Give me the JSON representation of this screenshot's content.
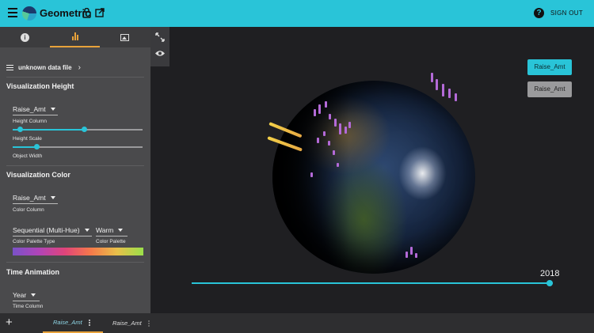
{
  "header": {
    "app_title": "Geometric",
    "sign_out_label": "SIGN OUT",
    "help_glyph": "?",
    "icons": [
      "menu-icon",
      "geometric-logo",
      "lock-icon",
      "open-external-icon",
      "help-icon"
    ]
  },
  "sidebar": {
    "tabs": [
      {
        "icon": "info-icon",
        "glyph": "i",
        "active": false
      },
      {
        "icon": "bar-chart-icon",
        "active": true
      },
      {
        "icon": "image-icon",
        "active": false
      }
    ],
    "data_file_label": "unknown data file",
    "chevron_glyph": "›",
    "height_section": {
      "title": "Visualization Height",
      "height_column_value": "Raise_Amt",
      "height_column_label": "Height Column",
      "height_scale_label": "Height Scale",
      "height_scale_value": 0.55,
      "object_width_label": "Object Width",
      "object_width_value": 0.18
    },
    "color_section": {
      "title": "Visualization Color",
      "color_column_value": "Raise_Amt",
      "color_column_label": "Color Column",
      "palette_type_value": "Sequential (Multi-Hue)",
      "palette_type_label": "Color Palette Type",
      "palette_value": "Warm",
      "palette_label": "Color Palette"
    },
    "time_section": {
      "title": "Time Animation",
      "time_column_value": "Year",
      "time_column_label": "Time Column"
    }
  },
  "viewport": {
    "tools": [
      "expand-icon",
      "eye-icon"
    ],
    "legend_buttons": [
      "Raise_Amt",
      "Raise_Amt"
    ],
    "year_label": "2018",
    "time_slider_value": 1.0
  },
  "bottom_tabs": {
    "add_glyph": "+",
    "tabs": [
      {
        "label": "Raise_Amt",
        "active": true
      },
      {
        "label": "Raise_Amt",
        "active": false
      }
    ]
  },
  "colors": {
    "accent": "#29c4d8",
    "tab_highlight": "#e8a23a",
    "sidebar_bg": "#4a4a4c",
    "viewport_bg": "#1f1f22",
    "spike_color": "#b46ad8",
    "beam_color": "#f3d048"
  }
}
